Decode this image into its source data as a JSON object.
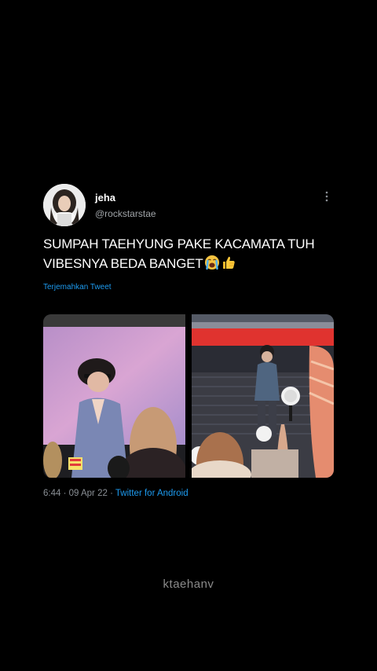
{
  "tweet": {
    "display_name": "jeha",
    "name_suffix_icon": "crescent-moon-icon",
    "handle": "@rockstarstae",
    "text": "SUMPAH TAEHYUNG PAKE KACAMATA TUH VIBESNYA BEDA BANGET",
    "emojis": [
      "crying-face-emoji",
      "thumbs-up-emoji"
    ],
    "translate_label": "Terjemahkan Tweet",
    "time": "6:44",
    "date": "09 Apr 22",
    "separator": "·",
    "source": "Twitter for Android",
    "media": [
      {
        "description_icon": "concert-screen-photo"
      },
      {
        "description_icon": "stadium-stage-photo"
      }
    ]
  },
  "watermark": "ktaehanv",
  "colors": {
    "background": "#000000",
    "text": "#ffffff",
    "secondary_text": "#8b9096",
    "link": "#1d9bf0"
  }
}
